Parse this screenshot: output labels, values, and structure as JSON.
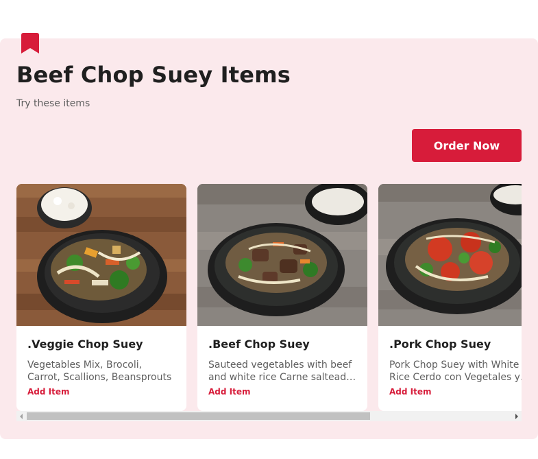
{
  "header": {
    "icon": "bookmark-icon",
    "title": "Beef Chop Suey Items",
    "subtitle": "Try these items",
    "order_button": "Order Now"
  },
  "items": [
    {
      "name": ".Veggie Chop Suey",
      "description": "Vegetables Mix, Brocoli, Carrot, Scallions, Beansprouts",
      "action": "Add Item"
    },
    {
      "name": ".Beef Chop Suey",
      "description": "Sauteed vegetables with beef and white rice Carne salteada con vegetales y arroz blanco",
      "action": "Add Item"
    },
    {
      "name": ".Pork Chop Suey",
      "description": "Pork Chop Suey with White Rice Cerdo con Vegetales y arroz blanco",
      "action": "Add Item"
    }
  ],
  "colors": {
    "accent": "#d71c3a",
    "panel_background": "#fbe9ec"
  }
}
